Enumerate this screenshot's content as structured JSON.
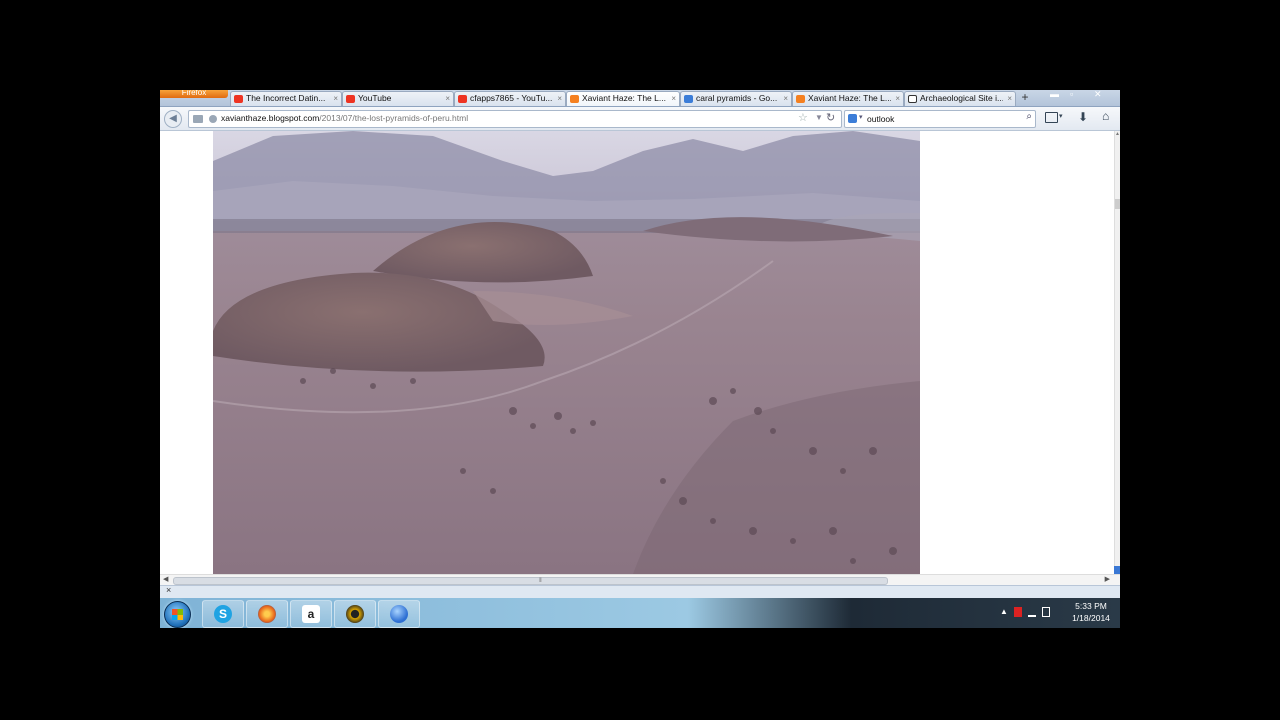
{
  "browser": {
    "menu_label": "Firefox",
    "tabs": [
      {
        "label": "The Incorrect Datin...",
        "favicon": "youtube-icon",
        "active": false
      },
      {
        "label": "YouTube",
        "favicon": "youtube-icon",
        "active": false
      },
      {
        "label": "cfapps7865 - YouTu...",
        "favicon": "youtube-icon",
        "active": false
      },
      {
        "label": "Xaviant Haze: The L...",
        "favicon": "blogger-icon",
        "active": true
      },
      {
        "label": "caral pyramids - Go...",
        "favicon": "google-icon",
        "active": false
      },
      {
        "label": "Xaviant Haze: The L...",
        "favicon": "blogger-icon",
        "active": false
      },
      {
        "label": "Archaeological Site i...",
        "favicon": "wikipedia-icon",
        "active": false
      }
    ],
    "new_tab_symbol": "+",
    "tab_close_symbol": "×",
    "url_domain": "xavianthaze.blogspot.com",
    "url_path": "/2013/07/the-lost-pyramids-of-peru.html",
    "search_engine": "google-icon",
    "search_value": "outlook"
  },
  "colors": {
    "tab_bar": "#b3c4da",
    "firefox_button": "#e06a10",
    "taskbar_left": "#7fb3d6",
    "taskbar_right": "#2a3a48",
    "scroll_accent": "#3a78d4"
  },
  "taskbar": {
    "apps": [
      {
        "name": "skype-icon",
        "glyph": "S",
        "color": "#1fa3e3"
      },
      {
        "name": "firefox-icon",
        "glyph": "",
        "color": "#e8661c"
      },
      {
        "name": "amazon-icon",
        "glyph": "a",
        "color": "#222"
      },
      {
        "name": "media-player-icon",
        "glyph": "",
        "color": "#d9a400"
      },
      {
        "name": "google-earth-icon",
        "glyph": "",
        "color": "#2d6fd3"
      }
    ],
    "clock_time": "5:33 PM",
    "clock_date": "1/18/2014"
  }
}
